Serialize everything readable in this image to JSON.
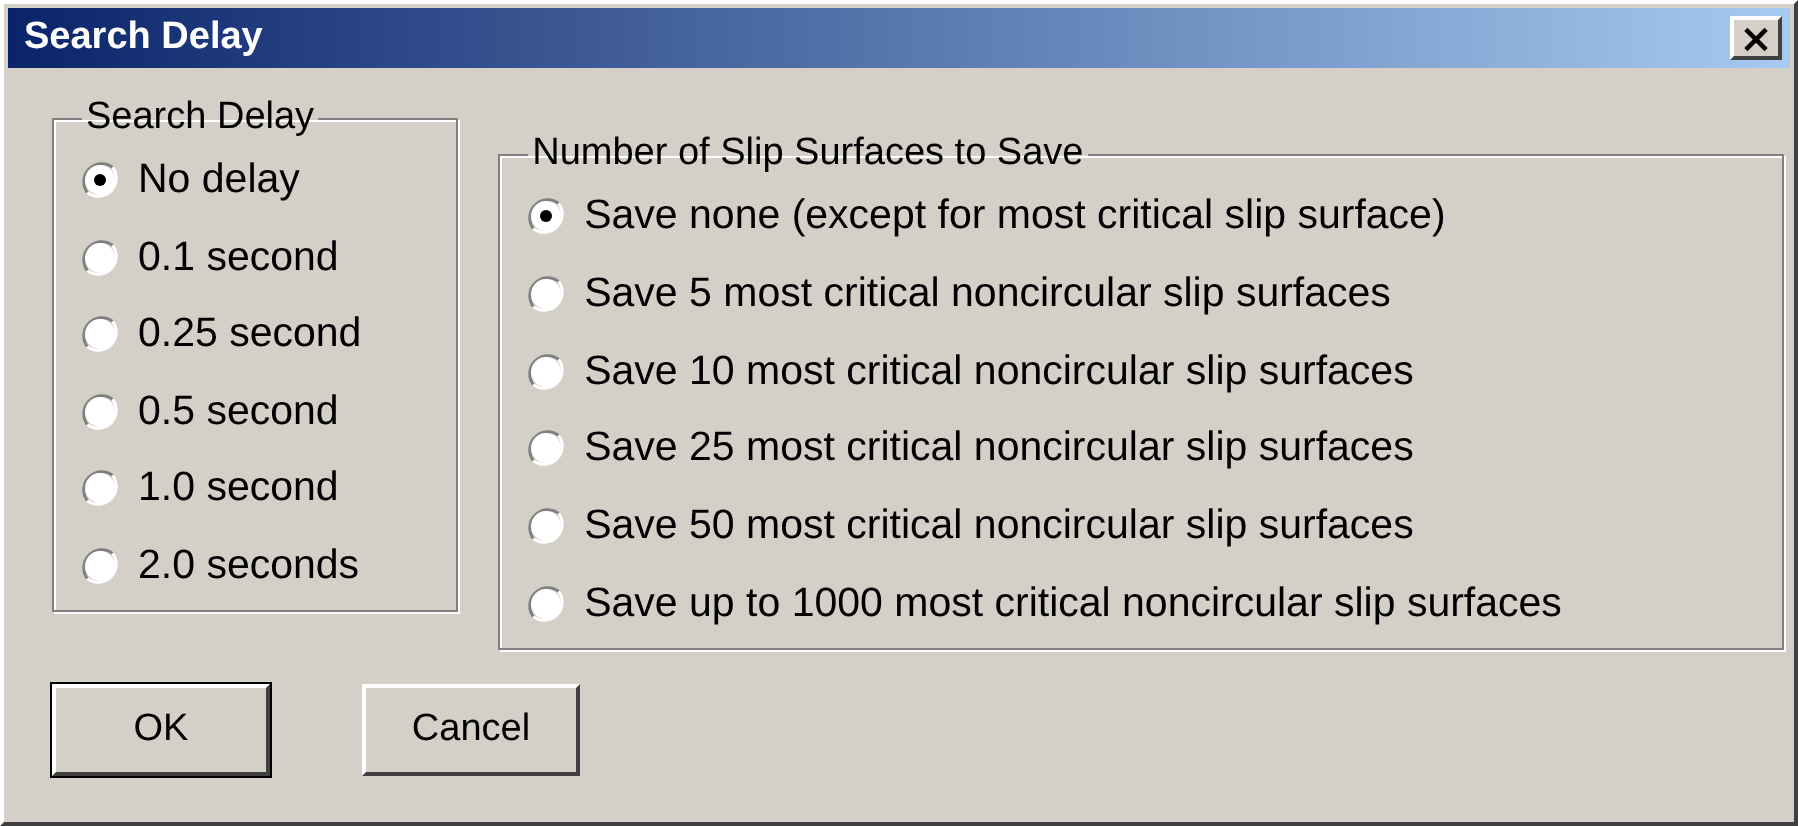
{
  "window": {
    "title": "Search Delay",
    "close_label": "×"
  },
  "groups": [
    {
      "title": "Search Delay",
      "options": [
        {
          "label": "No delay",
          "selected": true
        },
        {
          "label": "0.1 second",
          "selected": false
        },
        {
          "label": "0.25 second",
          "selected": false
        },
        {
          "label": "0.5 second",
          "selected": false
        },
        {
          "label": "1.0 second",
          "selected": false
        },
        {
          "label": "2.0 seconds",
          "selected": false
        }
      ]
    },
    {
      "title": "Number of Slip Surfaces to Save",
      "options": [
        {
          "label": "Save none (except for most critical slip surface)",
          "selected": true
        },
        {
          "label": "Save 5 most critical noncircular slip surfaces",
          "selected": false
        },
        {
          "label": "Save 10 most critical noncircular slip surfaces",
          "selected": false
        },
        {
          "label": "Save 25 most critical noncircular slip surfaces",
          "selected": false
        },
        {
          "label": "Save 50 most critical noncircular slip surfaces",
          "selected": false
        },
        {
          "label": "Save up to 1000 most critical noncircular slip surfaces",
          "selected": false
        }
      ]
    }
  ],
  "buttons": [
    {
      "label": "OK",
      "default": true
    },
    {
      "label": "Cancel",
      "default": false
    }
  ]
}
